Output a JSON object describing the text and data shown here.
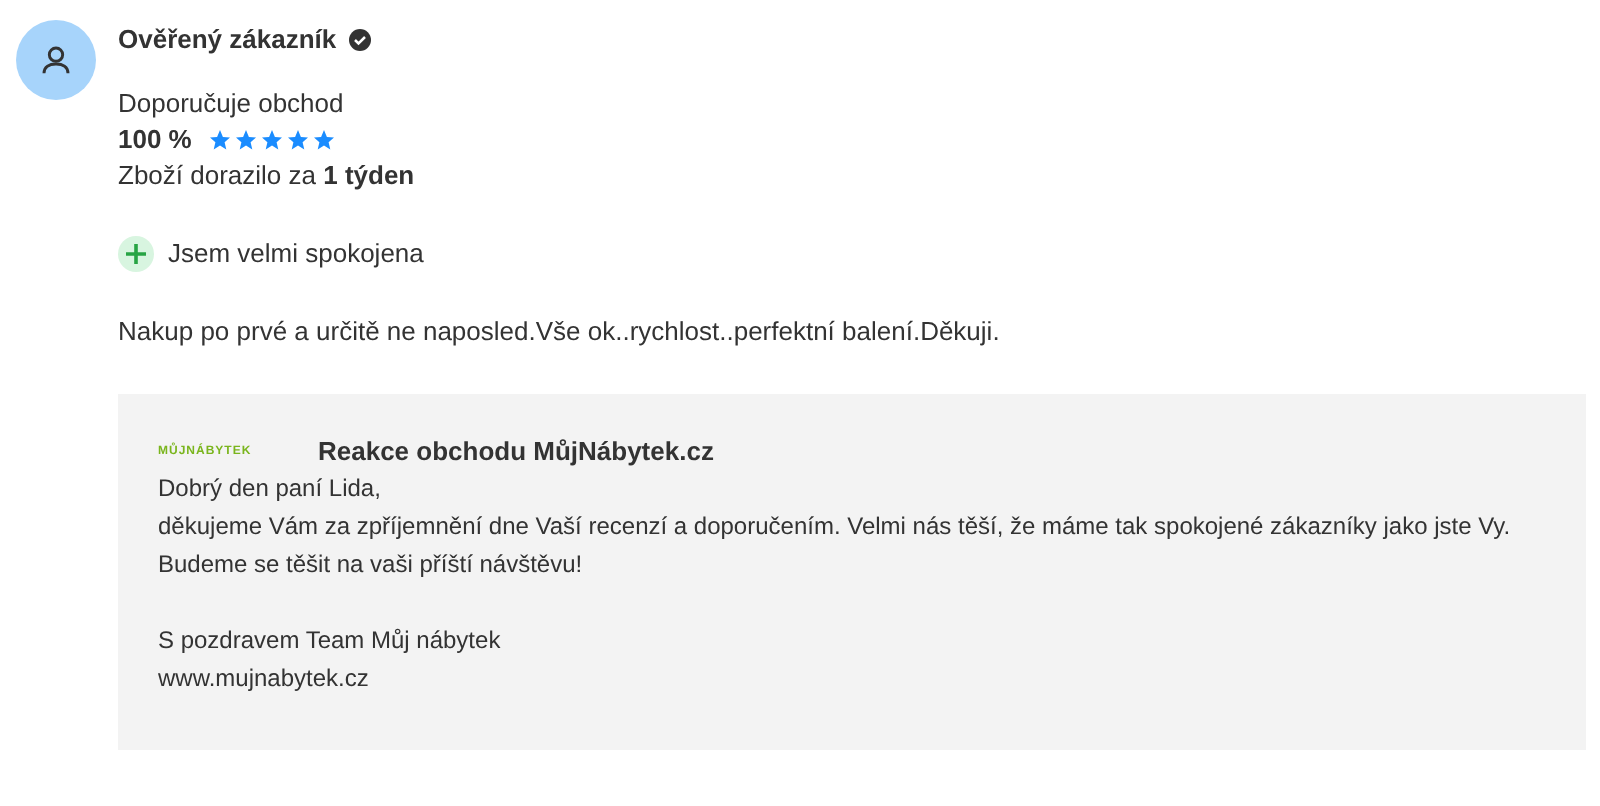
{
  "review": {
    "author": "Ověřený zákazník",
    "verified": true,
    "recommend_label": "Doporučuje obchod",
    "percent": "100 %",
    "stars": 5,
    "delivery": "Zboží dorazilo za **1 týden**",
    "pros": [
      {
        "kind": "plus",
        "text": "Jsem velmi spokojena"
      }
    ],
    "text": "Nakup po prvé a určitě ne naposled.Vše ok..rychlost..perfektní balení.Děkuji."
  },
  "reply": {
    "logo": "MŮJNÁBYTEK",
    "title": "Reakce obchodu MůjNábytek.cz",
    "paragraphs": [
      "Dobrý den paní Lida,",
      "děkujeme Vám za zpříjemnění dne Vaší recenzí a doporučením. Velmi nás těší, že máme tak spokojené zákazníky jako jste Vy.",
      "Budeme se těšit na vaši příští návštěvu!"
    ],
    "signature": [
      "S pozdravem Team Můj nábytek",
      "www.mujnabytek.cz"
    ]
  }
}
